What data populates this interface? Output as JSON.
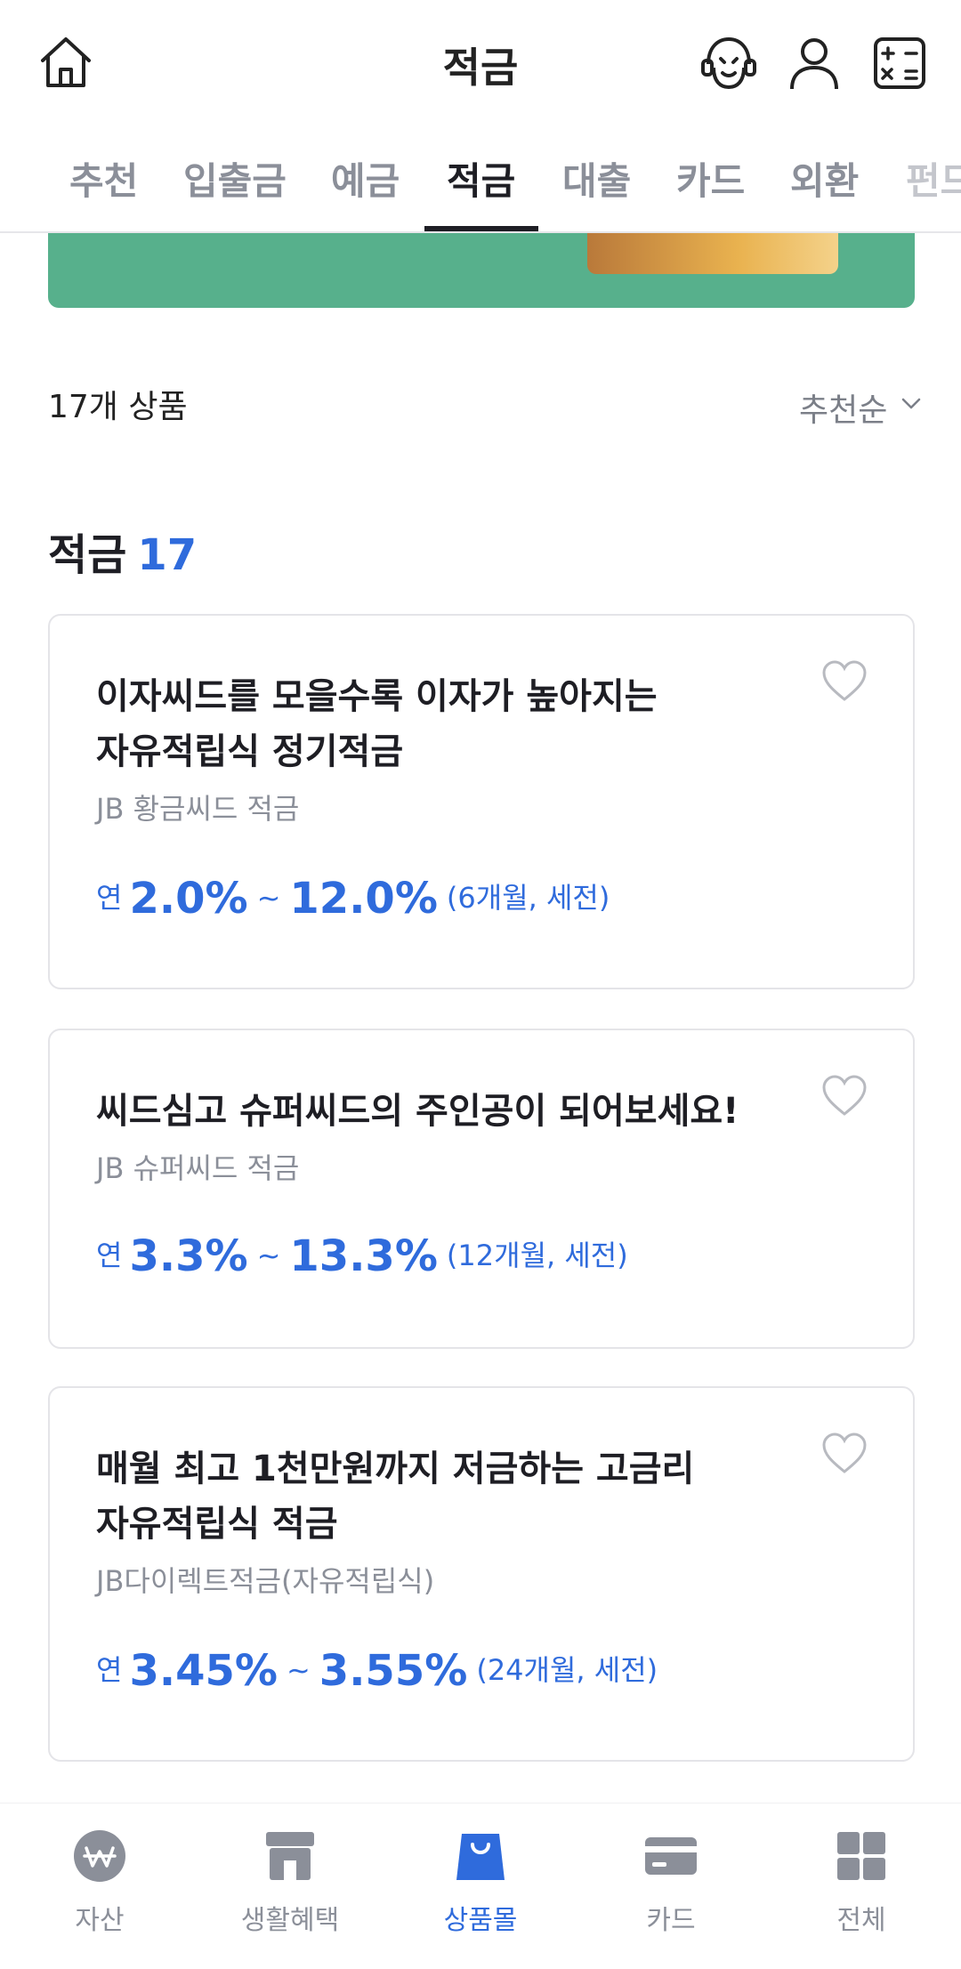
{
  "header": {
    "title": "적금",
    "icons": [
      "home-icon",
      "support-agent-icon",
      "person-icon",
      "calculator-icon"
    ]
  },
  "tabs": [
    {
      "label": "추천",
      "active": false
    },
    {
      "label": "입출금",
      "active": false
    },
    {
      "label": "예금",
      "active": false
    },
    {
      "label": "적금",
      "active": true
    },
    {
      "label": "대출",
      "active": false
    },
    {
      "label": "카드",
      "active": false
    },
    {
      "label": "외환",
      "active": false
    },
    {
      "label": "펀드",
      "active": false
    }
  ],
  "list": {
    "count_label": "17개 상품",
    "sort_label": "추천순",
    "section_title": "적금",
    "section_count": "17"
  },
  "products": [
    {
      "headline_line1": "이자씨드를 모을수록 이자가 높아지는",
      "headline_line2": "자유적립식 정기적금",
      "name": "JB 황금씨드 적금",
      "rate_prefix": "연",
      "rate_min": "2.0%",
      "rate_sep": "~",
      "rate_max": "12.0%",
      "term": "(6개월, 세전)"
    },
    {
      "headline_line1": "씨드심고 슈퍼씨드의 주인공이 되어보세요!",
      "headline_line2": "",
      "name": "JB 슈퍼씨드 적금",
      "rate_prefix": "연",
      "rate_min": "3.3%",
      "rate_sep": "~",
      "rate_max": "13.3%",
      "term": "(12개월, 세전)"
    },
    {
      "headline_line1": "매월 최고 1천만원까지 저금하는 고금리",
      "headline_line2": "자유적립식 적금",
      "name": "JB다이렉트적금(자유적립식)",
      "rate_prefix": "연",
      "rate_min": "3.45%",
      "rate_sep": "~",
      "rate_max": "3.55%",
      "term": "(24개월, 세전)"
    }
  ],
  "bottom_nav": [
    {
      "label": "자산",
      "icon": "won-coin-icon",
      "active": false
    },
    {
      "label": "생활혜택",
      "icon": "store-icon",
      "active": false
    },
    {
      "label": "상품몰",
      "icon": "shopping-bag-icon",
      "active": true
    },
    {
      "label": "카드",
      "icon": "card-icon",
      "active": false
    },
    {
      "label": "전체",
      "icon": "grid-icon",
      "active": false
    }
  ],
  "colors": {
    "accent": "#2f6bdc",
    "banner": "#57b08c",
    "muted": "#8b8f99",
    "text": "#1e1e24"
  }
}
